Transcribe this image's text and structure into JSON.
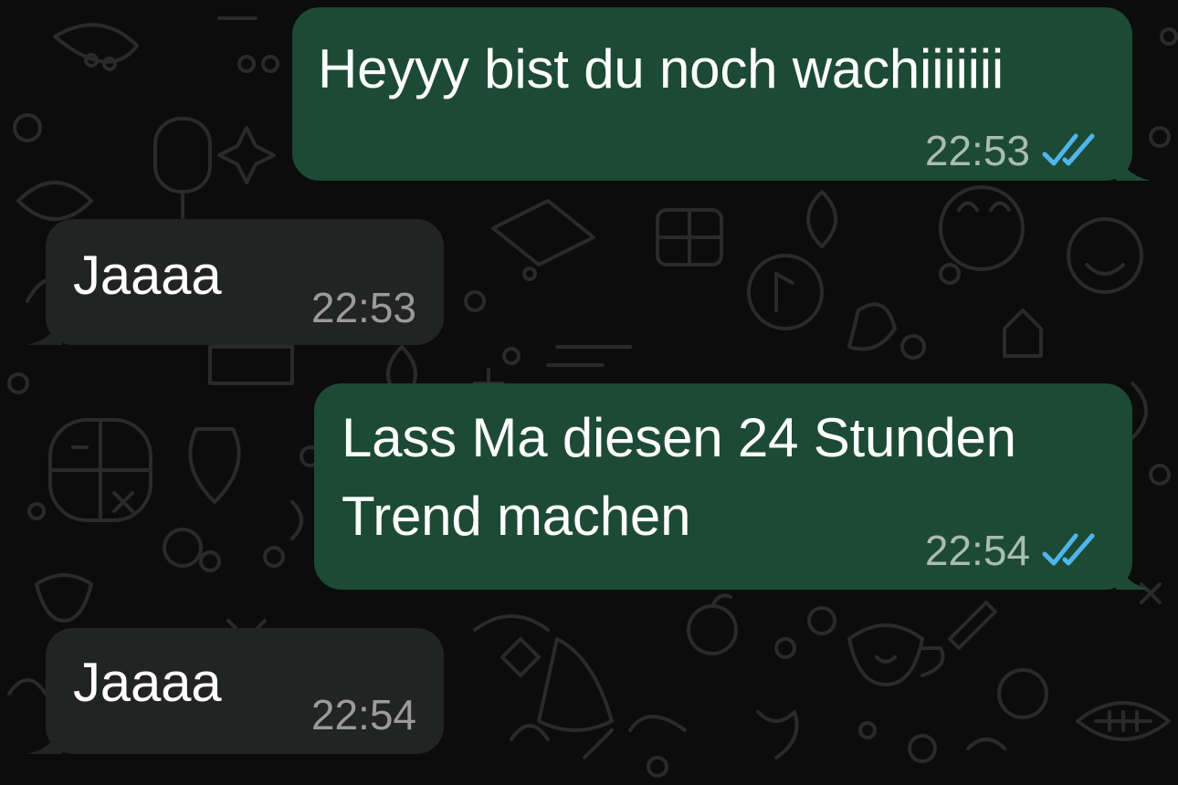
{
  "colors": {
    "background": "#0c0c0c",
    "outgoing_bubble": "#1d4a35",
    "incoming_bubble": "#222424",
    "read_ticks": "#4fb6ec",
    "message_text": "#ffffff"
  },
  "messages": [
    {
      "direction": "outgoing",
      "lines": [
        "Heyyy bist du noch wachiiiiiii"
      ],
      "time": "22:53",
      "status": "read",
      "status_icon": "double-check-icon"
    },
    {
      "direction": "incoming",
      "lines": [
        "Jaaaa"
      ],
      "time": "22:53"
    },
    {
      "direction": "outgoing",
      "lines": [
        "Lass Ma diesen 24 Stunden",
        "Trend machen"
      ],
      "time": "22:54",
      "status": "read",
      "status_icon": "double-check-icon"
    },
    {
      "direction": "incoming",
      "lines": [
        "Jaaaa"
      ],
      "time": "22:54"
    }
  ]
}
